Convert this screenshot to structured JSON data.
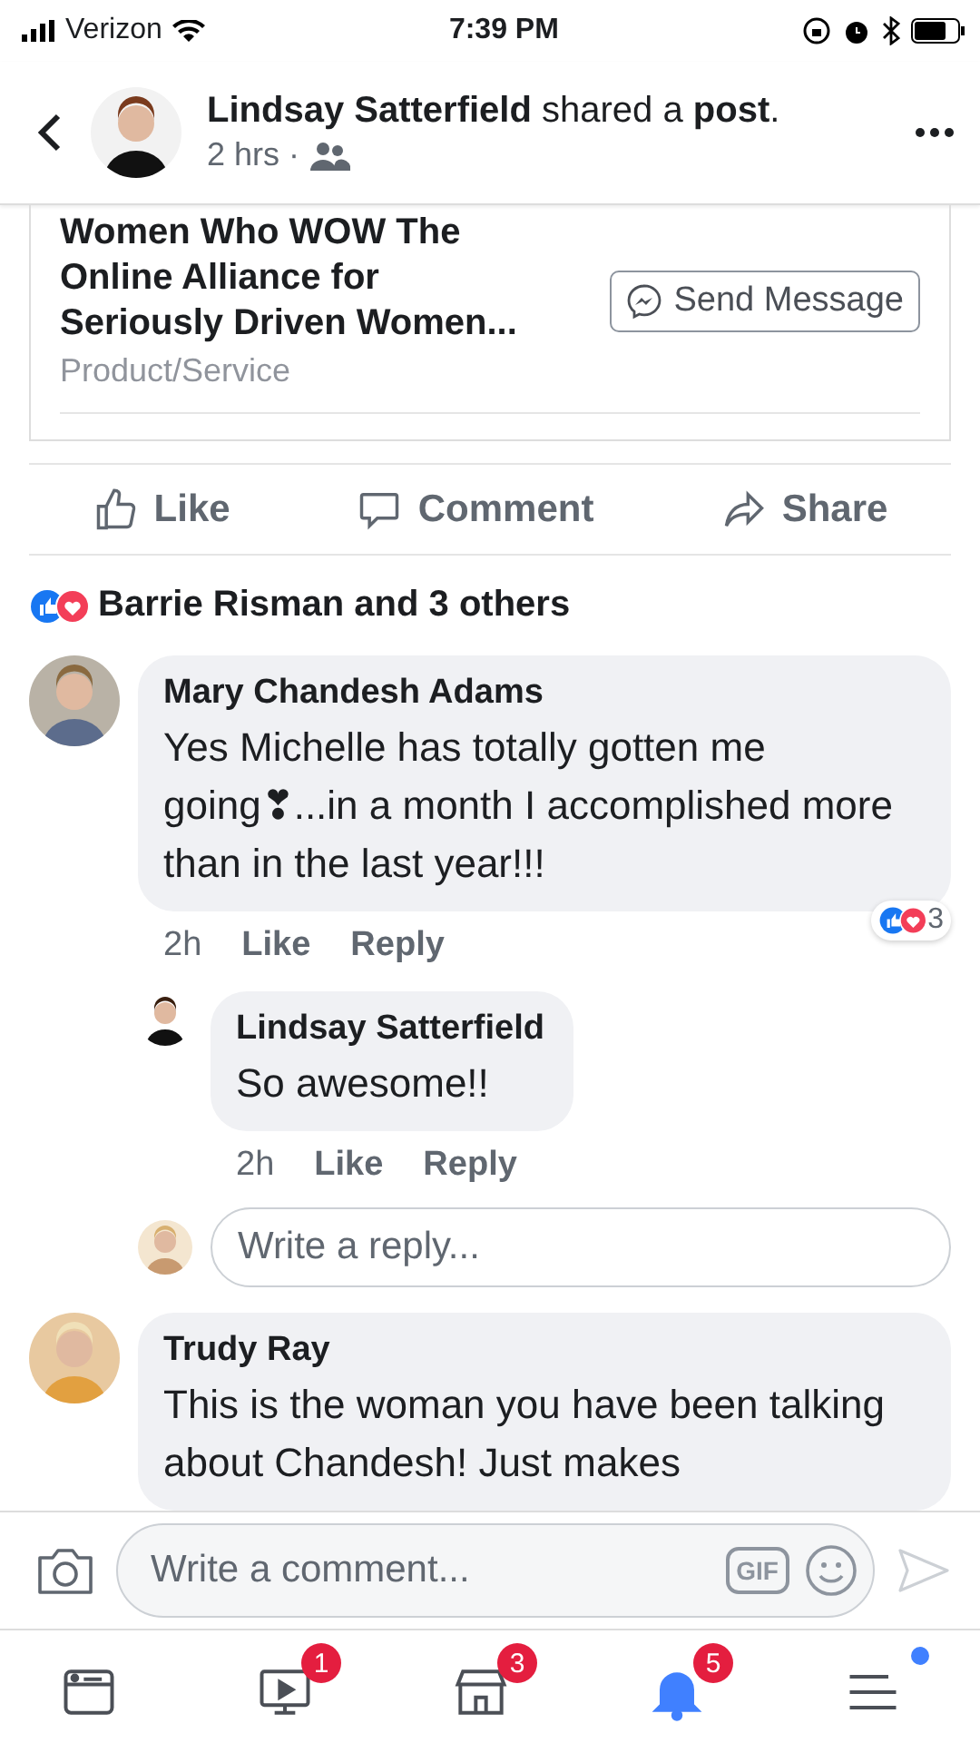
{
  "status_bar": {
    "carrier": "Verizon",
    "time": "7:39 PM"
  },
  "header": {
    "author": "Lindsay Satterfield",
    "action": "shared a **post**.",
    "time": "2 hrs ·"
  },
  "page_card": {
    "title_lines": [
      "Women Who WOW The",
      "Online Alliance for",
      "Seriously Driven Women..."
    ],
    "category": "Product/Service",
    "button": "Send Message"
  },
  "actions": [
    {
      "kind": "like",
      "label": "Like"
    },
    {
      "kind": "comment",
      "label": "Comment"
    },
    {
      "kind": "share",
      "label": "Share"
    }
  ],
  "reactions_summary": "Barrie Risman and 3 others",
  "comments": [
    {
      "author": "Mary Chandesh Adams",
      "text": "Yes Michelle has totally gotten me going❣...in a month I accomplished more than in the last year!!!",
      "time": "2h",
      "like": "Like",
      "reply": "Reply",
      "reaction_count": "3",
      "replies": [
        {
          "author": "Lindsay Satterfield",
          "text": "So awesome!!",
          "time": "2h",
          "like": "Like",
          "reply": "Reply"
        }
      ],
      "reply_placeholder": "Write a reply..."
    },
    {
      "author": "Trudy Ray",
      "text": "This is the woman you have been talking about Chandesh! Just makes"
    }
  ],
  "composer": {
    "placeholder": "Write a comment...",
    "gif": "GIF"
  },
  "nav": [
    {
      "kind": "feed",
      "selected": false
    },
    {
      "kind": "video",
      "badge": "1",
      "selected": false
    },
    {
      "kind": "market",
      "badge": "3",
      "selected": false
    },
    {
      "kind": "bell",
      "badge": "5",
      "selected": true
    },
    {
      "kind": "menu",
      "indicator": true,
      "selected": false
    }
  ]
}
